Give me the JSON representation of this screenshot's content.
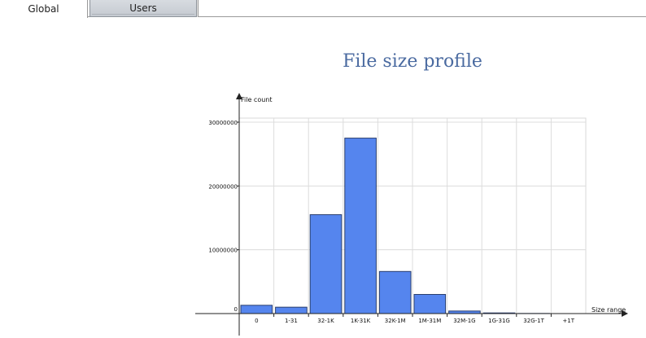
{
  "tabs": [
    {
      "label": "Global",
      "active": true
    },
    {
      "label": "Users",
      "active": false
    }
  ],
  "chart_data": {
    "type": "bar",
    "title": "File size profile",
    "ylabel": "File count",
    "xlabel": "Size range",
    "categories": [
      "0",
      "1-31",
      "32-1K",
      "1K-31K",
      "32K-1M",
      "1M-31M",
      "32M-1G",
      "1G-31G",
      "32G-1T",
      "+1T"
    ],
    "values": [
      1300000,
      1000000,
      15500000,
      27500000,
      6600000,
      3000000,
      400000,
      100000,
      20000,
      0
    ],
    "yticks": [
      0,
      10000000,
      20000000,
      30000000
    ],
    "ytick_labels": [
      "0",
      "10000000",
      "20000000",
      "30000000"
    ],
    "ylim": [
      0,
      30000000
    ],
    "grid": true,
    "bar_color": "#5585ee",
    "bar_edge_color": "#2a3f6e"
  }
}
